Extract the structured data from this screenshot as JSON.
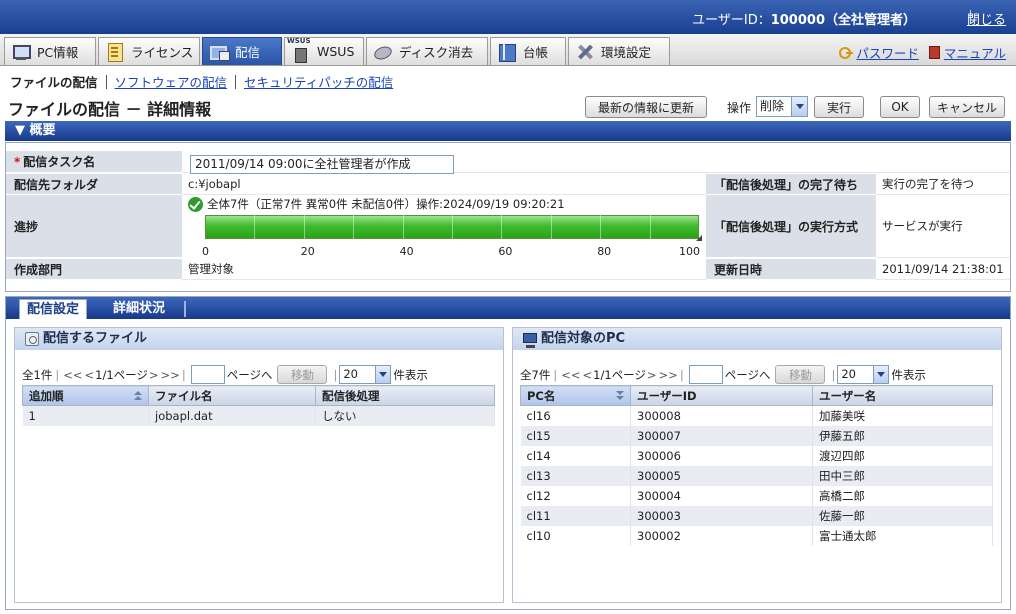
{
  "topbar": {
    "user_prefix": "ユーザーID：",
    "user_id": "100000（全社管理者）",
    "close": "閉じる"
  },
  "tabs": [
    {
      "label": "PC情報",
      "icon": "pc-icon"
    },
    {
      "label": "ライセンス",
      "icon": "license-icon"
    },
    {
      "label": "配信",
      "icon": "distribution-icon",
      "active": true
    },
    {
      "label": "WSUS",
      "icon": "wsus-icon"
    },
    {
      "label": "ディスク消去",
      "icon": "disk-erase-icon"
    },
    {
      "label": "台帳",
      "icon": "ledger-icon"
    },
    {
      "label": "環境設定",
      "icon": "settings-tools-icon"
    }
  ],
  "links": {
    "password": "パスワード",
    "manual": "マニュアル"
  },
  "subnav": {
    "current": "ファイルの配信",
    "software": "ソフトウェアの配信",
    "patch": "セキュリティパッチの配信"
  },
  "page_title": "ファイルの配信 － 詳細情報",
  "toolbar": {
    "refresh": "最新の情報に更新",
    "operation_label": "操作",
    "operation_value": "削除",
    "execute": "実行",
    "ok": "OK",
    "cancel": "キャンセル"
  },
  "summary": {
    "header": "▼ 概要",
    "task_name_label": "配信タスク名",
    "task_name_value": "2011/09/14 09:00に全社管理者が作成",
    "folder_label": "配信先フォルダ",
    "folder_value": "c:¥jobapl",
    "progress_label": "進捗",
    "progress_text": "全体7件（正常7件 異常0件 未配信0件）操作:2024/09/19 09:20:21",
    "progress_fraction": 1.0,
    "progress_scale": [
      "0",
      "20",
      "40",
      "60",
      "80",
      "100"
    ],
    "dept_label": "作成部門",
    "dept_value": "管理対象",
    "wait_label": "「配信後処理」の完了待ち",
    "wait_value": "実行の完了を待つ",
    "method_label": "「配信後処理」の実行方式",
    "method_value": "サービスが実行",
    "updated_label": "更新日時",
    "updated_value": "2011/09/14 21:38:01"
  },
  "lower_tabs": {
    "settings": "配信設定",
    "details": "詳細状況"
  },
  "files_panel": {
    "title": "配信するファイル",
    "pager": {
      "count": "全1件",
      "first": "<<",
      "prev": "<",
      "page": "1/1ページ",
      "next": ">",
      "last": ">>",
      "goto_suffix": "ページへ",
      "move": "移動",
      "per_page": "20",
      "per_page_suffix": "件表示"
    },
    "columns": [
      "追加順",
      "ファイル名",
      "配信後処理"
    ],
    "rows": [
      [
        "1",
        "jobapl.dat",
        "しない"
      ]
    ]
  },
  "pcs_panel": {
    "title": "配信対象のPC",
    "pager": {
      "count": "全7件",
      "first": "<<",
      "prev": "<",
      "page": "1/1ページ",
      "next": ">",
      "last": ">>",
      "goto_suffix": "ページへ",
      "move": "移動",
      "per_page": "20",
      "per_page_suffix": "件表示"
    },
    "columns": [
      "PC名",
      "ユーザーID",
      "ユーザー名"
    ],
    "rows": [
      [
        "cl16",
        "300008",
        "加藤美咲"
      ],
      [
        "cl15",
        "300007",
        "伊藤五郎"
      ],
      [
        "cl14",
        "300006",
        "渡辺四郎"
      ],
      [
        "cl13",
        "300005",
        "田中三郎"
      ],
      [
        "cl12",
        "300004",
        "高橋二郎"
      ],
      [
        "cl11",
        "300003",
        "佐藤一郎"
      ],
      [
        "cl10",
        "300002",
        "富士通太郎"
      ]
    ]
  }
}
